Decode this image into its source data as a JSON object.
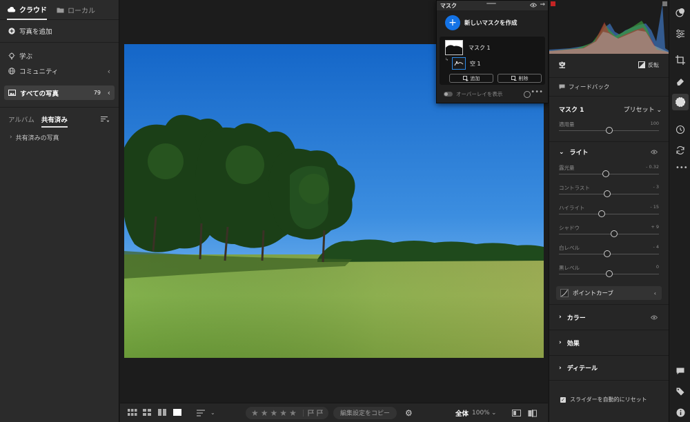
{
  "left_panel": {
    "tabs": [
      {
        "label": "クラウド",
        "active": true
      },
      {
        "label": "ローカル",
        "active": false
      }
    ],
    "add_photos": "写真を追加",
    "learn": "学ぶ",
    "community": "コミュニティ",
    "all_photos": {
      "label": "すべての写真",
      "count": "79"
    },
    "album_tabs": [
      {
        "label": "アルバム",
        "active": false
      },
      {
        "label": "共有済み",
        "active": true
      }
    ],
    "shared_photos": "共有済みの写真"
  },
  "mask_panel": {
    "title": "マスク",
    "new_mask": "新しいマスクを作成",
    "mask_name": "マスク 1",
    "component": "空 1",
    "add_label": "追加",
    "delete_label": "削除",
    "overlay_label": "オーバーレイを表示"
  },
  "edit_panel": {
    "sky_label": "空",
    "invert_label": "反転",
    "feedback_label": "フィードバック",
    "mask_label": "マスク 1",
    "preset_label": "プリセット",
    "amount": {
      "label": "適用量",
      "value": "100",
      "position": 0.5
    },
    "light_section": "ライト",
    "light_sliders": [
      {
        "label": "露光量",
        "value": "- 0.32",
        "position": 0.47
      },
      {
        "label": "コントラスト",
        "value": "- 3",
        "position": 0.48
      },
      {
        "label": "ハイライト",
        "value": "- 15",
        "position": 0.43
      },
      {
        "label": "シャドウ",
        "value": "+ 9",
        "position": 0.55
      },
      {
        "label": "白レベル",
        "value": "- 4",
        "position": 0.48
      },
      {
        "label": "黒レベル",
        "value": "0",
        "position": 0.5
      }
    ],
    "point_curve": "ポイントカーブ",
    "color_section": "カラー",
    "effects_section": "効果",
    "detail_section": "ディテール",
    "auto_reset_label": "スライダーを自動的にリセット"
  },
  "bottom_bar": {
    "copy_settings": "編集設定をコピー",
    "zoom_fit": "全体",
    "zoom_percent": "100%"
  },
  "colors": {
    "accent": "#1473e6",
    "panel": "#262626",
    "sky": "#2f7fd6"
  }
}
